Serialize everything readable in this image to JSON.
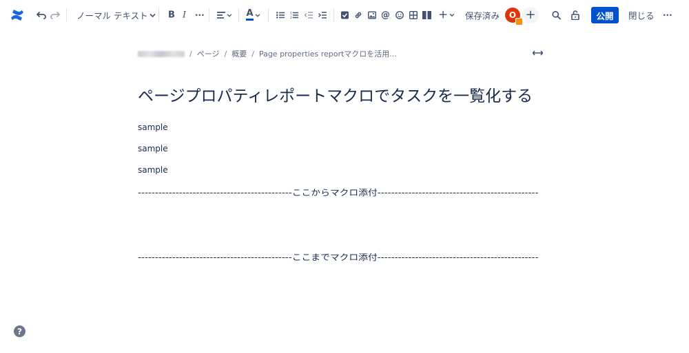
{
  "toolbar": {
    "logo_icon": "confluence-logo-icon",
    "undo_icon": "undo-icon",
    "redo_icon": "redo-icon",
    "text_style": "ノーマル テキスト",
    "bold_label": "B",
    "italic_label": "I",
    "more_format_label": "···",
    "align_icon": "align-left-icon",
    "text_color_label": "A",
    "text_color": "#0052cc",
    "bullet_list_icon": "bullet-list-icon",
    "numbered_list_icon": "numbered-list-icon",
    "outdent_icon": "outdent-icon",
    "indent_icon": "indent-icon",
    "task_icon": "checkbox-icon",
    "link_icon": "link-icon",
    "image_icon": "image-icon",
    "mention_label": "@",
    "emoji_icon": "emoji-icon",
    "table_icon": "table-icon",
    "layout_icon": "layout-icon",
    "insert_label": "+",
    "save_status": "保存済み",
    "avatar_initial": "O",
    "avatar_color": "#de350b",
    "invite_label": "+",
    "search_icon": "search-icon",
    "restrictions_icon": "unlock-icon",
    "publish_label": "公開",
    "publish_color": "#0052cc",
    "close_label": "閉じる",
    "more_label": "···"
  },
  "breadcrumb": {
    "space_obscured": true,
    "items": [
      "ページ",
      "概要",
      "Page properties reportマクロを活用..."
    ],
    "separator": "/"
  },
  "width_toggle_icon": "expand-width-icon",
  "page": {
    "title": "ページプロパティレポートマクロでタスクを一覧化する",
    "paragraphs": [
      "sample",
      "sample",
      "sample"
    ],
    "macro_start": "---------------------------------------------ここからマクロ添付-----------------------------------------------",
    "macro_end": "---------------------------------------------ここまでマクロ添付-----------------------------------------------"
  },
  "help_label": "?"
}
